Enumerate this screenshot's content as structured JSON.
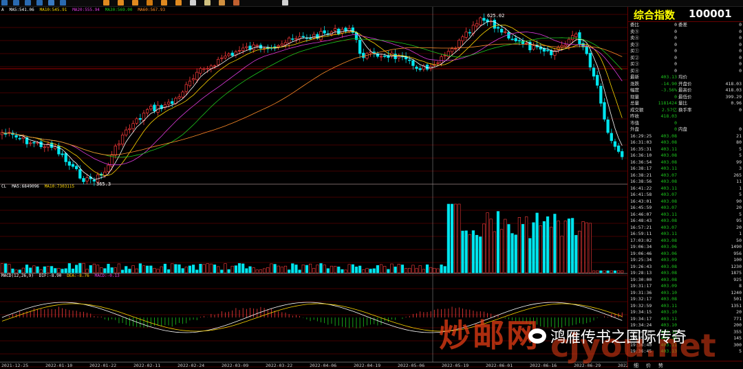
{
  "toolbar": {
    "icons": [
      "chart-icon",
      "bar-icon",
      "line-icon",
      "grid-icon",
      "zoom-in-icon",
      "zoom-out-icon",
      "cursor-icon",
      "draw-icon",
      "text-icon",
      "ruler-icon",
      "magnet-icon",
      "layer-icon",
      "lock-icon",
      "note-icon",
      "search-icon",
      "tools-icon",
      "gear-icon"
    ]
  },
  "main": {
    "ma_legend": [
      {
        "t": "A",
        "c": "#fff"
      },
      {
        "t": "MA5:541.06",
        "c": "#fff"
      },
      {
        "t": "MA10:545.91",
        "c": "#ffd700"
      },
      {
        "t": "MA20:555.94",
        "c": "#e03ce0"
      },
      {
        "t": "MA30:569.00",
        "c": "#1ec81e"
      },
      {
        "t": "MA60:567.93",
        "c": "#ff8c28"
      }
    ],
    "high_label": "625.02",
    "low_label": "365.3"
  },
  "volume": {
    "legend": [
      {
        "t": "CL",
        "c": "#fff"
      },
      {
        "t": "MA5:6849096",
        "c": "#fff"
      },
      {
        "t": "MA10:7303115",
        "c": "#ffd700"
      }
    ]
  },
  "macd": {
    "legend": [
      {
        "t": "MACD(12,26,9)",
        "c": "#fff"
      },
      {
        "t": "DIF:-8.90",
        "c": "#fff"
      },
      {
        "t": "DEA:-8.76",
        "c": "#ffd700"
      },
      {
        "t": "MACD:-0.13",
        "c": "#e03ce0"
      }
    ]
  },
  "dates": [
    "2021-12-25",
    "2022-01-10",
    "2022-01-22",
    "2022-02-11",
    "2022-02-24",
    "2022-03-09",
    "2022-03-22",
    "2022-04-06",
    "2022-04-19",
    "2022-05-06",
    "2022-05-19",
    "2022-06-01",
    "2022-06-16",
    "2022-06-29",
    "2022-07-1"
  ],
  "quote": {
    "title": "综合指数",
    "code": "100001",
    "rows1": [
      {
        "a": "委比",
        "b": "0",
        "c": "委差",
        "d": "0"
      },
      {
        "a": "卖⑤",
        "b": "0",
        "c": "",
        "d": "0"
      },
      {
        "a": "卖④",
        "b": "0",
        "c": "",
        "d": "0"
      },
      {
        "a": "卖③",
        "b": "0",
        "c": "",
        "d": "0"
      }
    ],
    "rows2": [
      {
        "a": "买①",
        "b": "0",
        "c": "",
        "d": "0"
      },
      {
        "a": "买②",
        "b": "0",
        "c": "",
        "d": "0"
      },
      {
        "a": "买③",
        "b": "0",
        "c": "",
        "d": "0"
      },
      {
        "a": "买④",
        "b": "0",
        "c": "",
        "d": "0"
      }
    ],
    "rows3": [
      {
        "a": "最新",
        "b": "403.13",
        "c": "均价",
        "d": ""
      },
      {
        "a": "涨跌",
        "b": "-14.90",
        "c": "开盘价",
        "d": "418.03"
      },
      {
        "a": "幅度",
        "b": "-3.56%",
        "c": "最高价",
        "d": "418.03"
      },
      {
        "a": "现量",
        "b": "0",
        "c": "最低价",
        "d": "399.29"
      },
      {
        "a": "总量",
        "b": "1181424",
        "c": "量比",
        "d": "0.96"
      },
      {
        "a": "成交额",
        "b": "2.57亿",
        "c": "换手率",
        "d": "0"
      },
      {
        "a": "昨收",
        "b": "418.03",
        "c": "",
        "d": ""
      },
      {
        "a": "市值",
        "b": "0",
        "c": "",
        "d": ""
      },
      {
        "a": "外盘",
        "b": "0",
        "c": "内盘",
        "d": "0"
      }
    ],
    "ticks": [
      [
        "16:29:25",
        "403.08",
        "21"
      ],
      [
        "16:31:03",
        "403.08",
        "80"
      ],
      [
        "16:35:31",
        "403.11",
        "5"
      ],
      [
        "16:36:10",
        "403.08",
        "5"
      ],
      [
        "16:36:54",
        "403.08",
        "99"
      ],
      [
        "16:38:17",
        "403.11",
        "3"
      ],
      [
        "16:38:21",
        "403.07",
        "265"
      ],
      [
        "16:38:56",
        "403.08",
        "11"
      ],
      [
        "16:41:22",
        "403.11",
        "1"
      ],
      [
        "16:41:58",
        "403.07",
        "5"
      ],
      [
        "16:43:01",
        "403.08",
        "90"
      ],
      [
        "16:45:59",
        "403.07",
        "20"
      ],
      [
        "16:46:07",
        "403.11",
        "5"
      ],
      [
        "16:48:43",
        "403.08",
        "95"
      ],
      [
        "16:57:21",
        "403.07",
        "20"
      ],
      [
        "16:59:11",
        "403.11",
        "1"
      ],
      [
        "17:03:02",
        "403.08",
        "50"
      ],
      [
        "19:06:34",
        "403.06",
        "1490"
      ],
      [
        "19:06:46",
        "403.06",
        "956"
      ],
      [
        "19:25:34",
        "403.09",
        "100"
      ],
      [
        "19:26:43",
        "403.08",
        "1230"
      ],
      [
        "19:28:13",
        "403.08",
        "1875"
      ],
      [
        "19:30:00",
        "403.08",
        "925"
      ],
      [
        "19:31:17",
        "403.09",
        "8"
      ],
      [
        "19:31:36",
        "403.10",
        "1240"
      ],
      [
        "19:32:17",
        "403.08",
        "501"
      ],
      [
        "19:32:59",
        "403.11",
        "1351"
      ],
      [
        "19:34:15",
        "403.10",
        "20"
      ],
      [
        "19:34:17",
        "403.11",
        "771"
      ],
      [
        "19:34:24",
        "403.10",
        "200"
      ],
      [
        "19:34:34",
        "403.12",
        "355"
      ],
      [
        "19:35:00",
        "403.11",
        "145"
      ],
      [
        "19:36:40",
        "403.11",
        "300"
      ],
      [
        "19:36:45",
        "403.13",
        "5"
      ]
    ]
  },
  "watermark": {
    "main": "炒邮网",
    "url": "cjyou.net",
    "brand": "鸿雁传书之国际传奇"
  },
  "side_tabs": [
    "细",
    "价",
    "势"
  ]
}
